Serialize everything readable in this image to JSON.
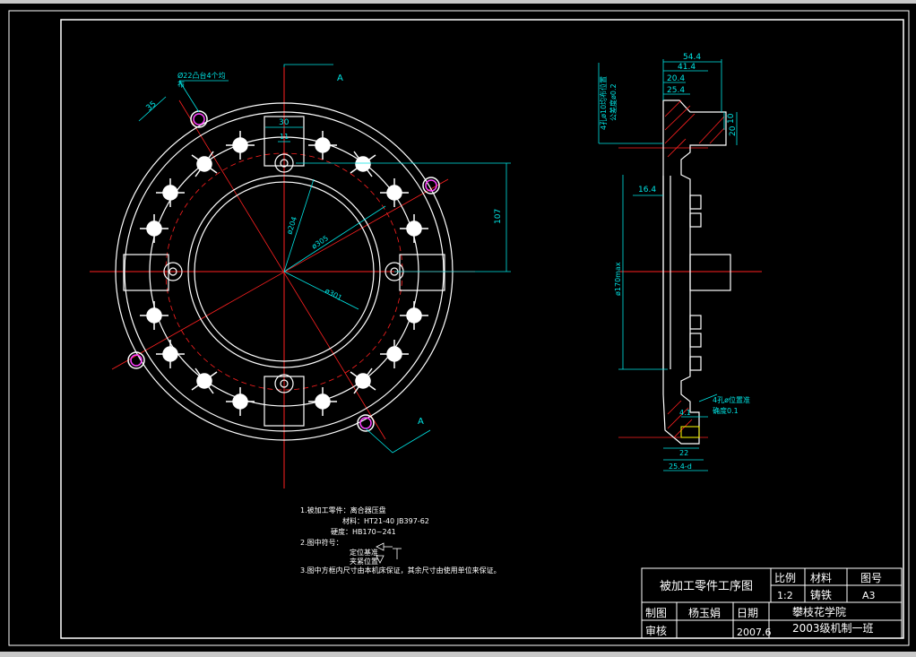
{
  "part_views": {
    "front": {
      "view_label_A_top": "A",
      "view_label_A_bottom": "A",
      "dims": {
        "hole_callout_1": "Ø22凸台4个均",
        "hole_callout_2": "布",
        "d35": "35",
        "d30": "30",
        "d11": "11",
        "d107": "107",
        "d204": "ø204",
        "d305": "ø305",
        "d301": "ø301"
      }
    },
    "side": {
      "dims": {
        "d54_4": "54.4",
        "d41_4": "41.4",
        "d20_4": "20.4",
        "d25_4": "25.4",
        "d10": "10",
        "d20": "20",
        "d16_4": "16.4",
        "d170": "ø170max",
        "d4_1": "4.1",
        "d22": "22",
        "d25_4b": "25.4-d"
      },
      "note_vertical_1": "4孔ø10均布位置",
      "note_vertical_2": "公差度ø0.2",
      "note_right_1": "4孔ø位置准",
      "note_right_2": "确度0.1"
    }
  },
  "notes": {
    "n1_title": "1.被加工零件：离合器压盘",
    "n1_material": "材料：HT21-40 JB397-62",
    "n1_hardness": "硬度：HB170~241",
    "n2_title": "2.图中符号：",
    "n2_locate": "定位基准",
    "n2_clamp": "夹紧位置",
    "n3": "3.图中方框内尺寸由本机床保证，其余尺寸由使用单位来保证。"
  },
  "title_block": {
    "name": "被加工零件工序图",
    "scale_label": "比例",
    "scale_value": "1:2",
    "material_label": "材料",
    "material_value": "铸铁",
    "drawing_no_label": "图号",
    "drawing_no_value": "A3",
    "drawn_label": "制图",
    "drawn_value": "杨玉娟",
    "date_label": "日期",
    "date_value": "2007.6",
    "review_label": "审核",
    "school": "攀枝花学院",
    "class": "2003级机制一班"
  },
  "colors": {
    "background": "#000000",
    "outline": "#ffffff",
    "center_line": "#ff2020",
    "dimension": "#00e5e5",
    "hatch": "#ff2020",
    "magenta": "#ff40ff",
    "yellow": "#ffff00"
  }
}
